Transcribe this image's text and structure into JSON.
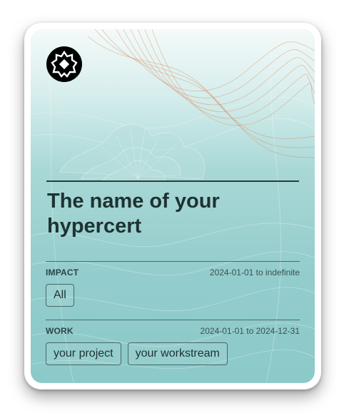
{
  "card": {
    "title": "The name of your hypercert",
    "impact": {
      "label": "IMPACT",
      "dates": "2024-01-01 to indefinite",
      "chips": [
        "All"
      ]
    },
    "work": {
      "label": "WORK",
      "dates": "2024-01-01 to 2024-12-31",
      "chips": [
        "your project",
        "your workstream"
      ]
    }
  },
  "icons": {
    "logo": "hypercert-logo-icon"
  },
  "colors": {
    "card_bg_top": "#f4faf9",
    "card_bg_bottom": "#8cc9c9",
    "title_text": "#1e3232",
    "accent_lines": "#d9865a"
  }
}
